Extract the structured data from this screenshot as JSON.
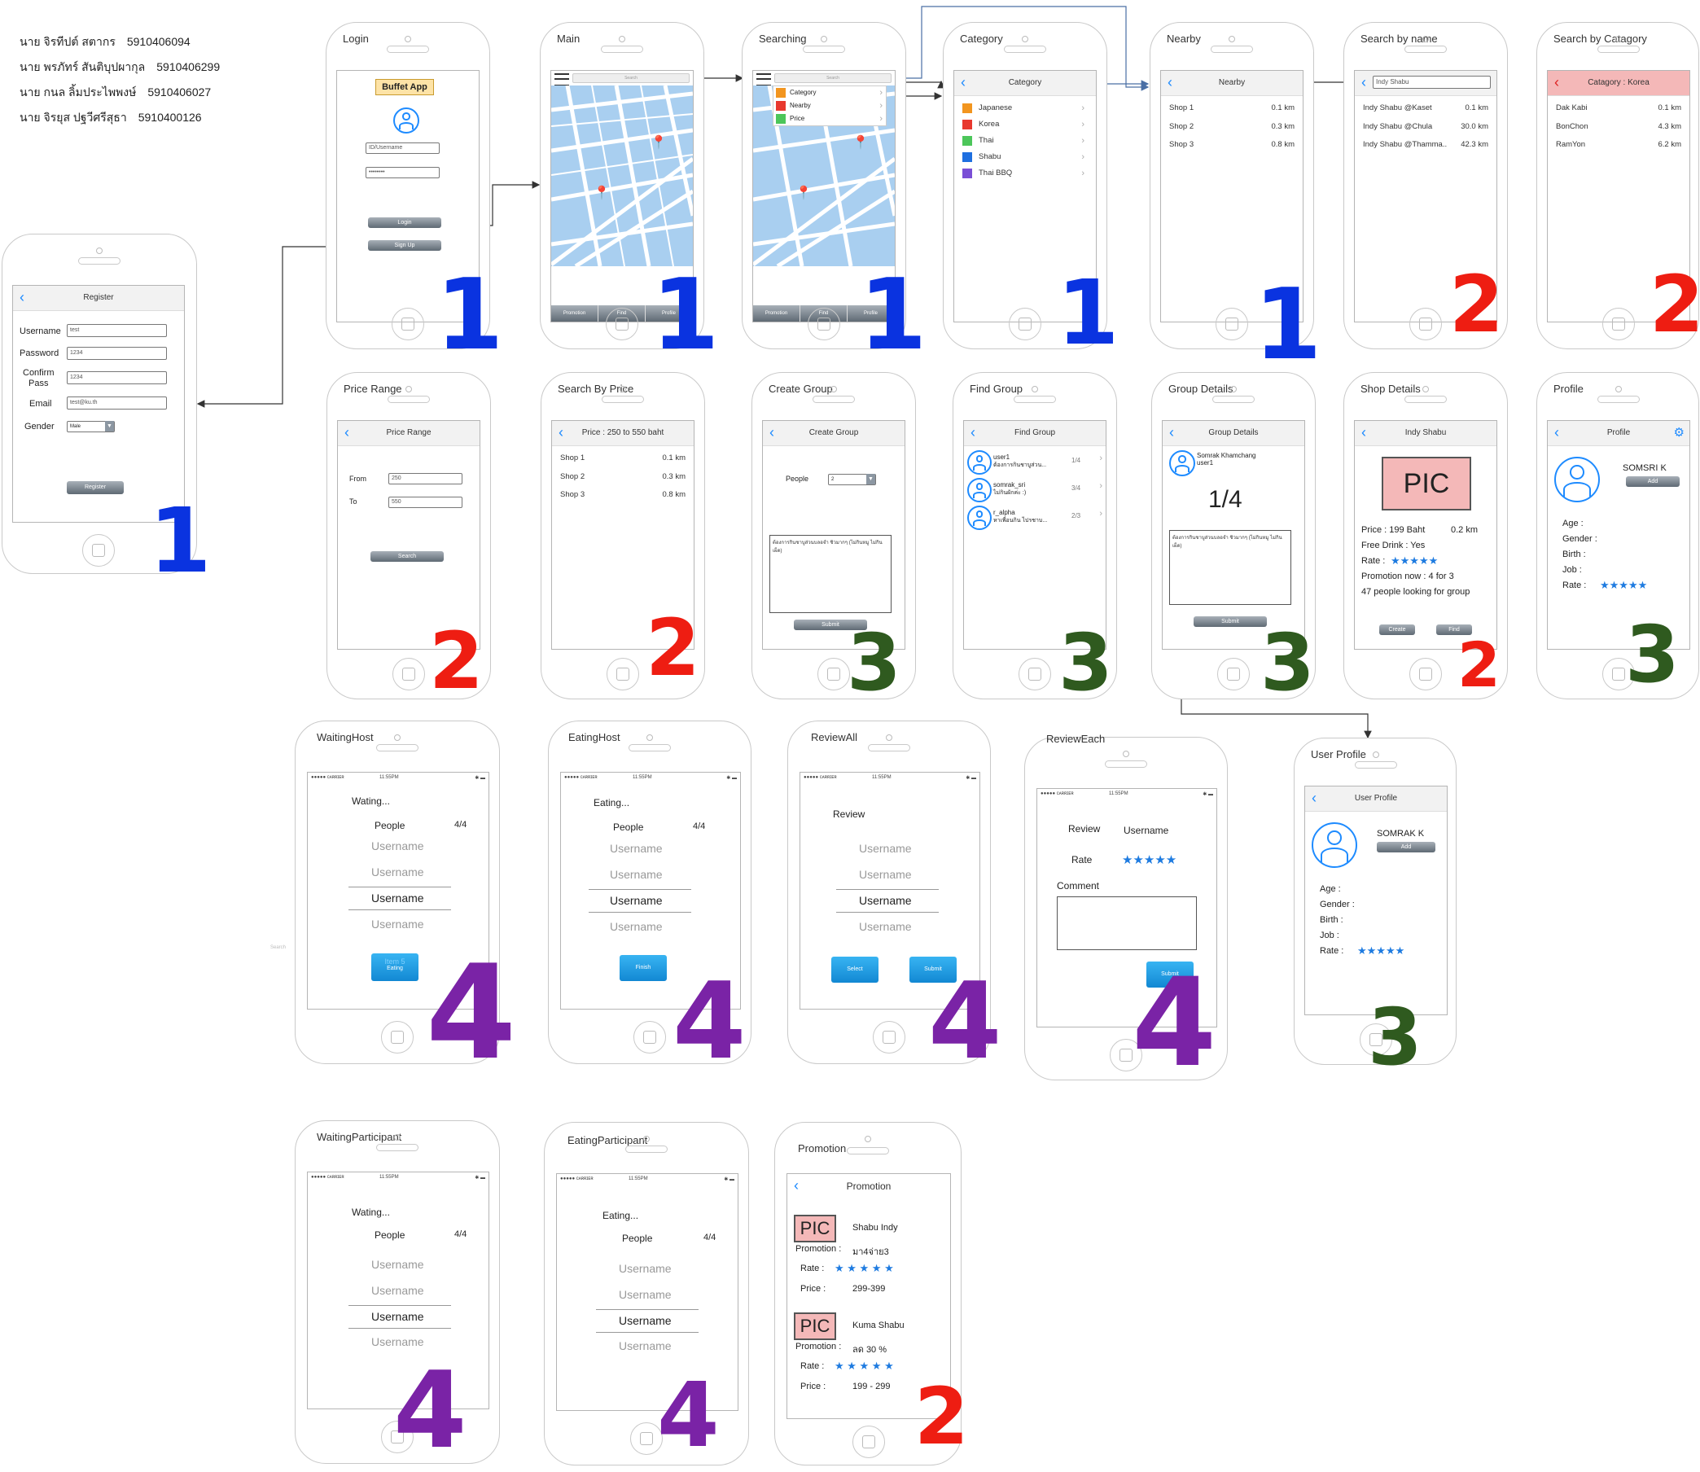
{
  "members": [
    {
      "name": "นาย จิรทีปต์ สตากร",
      "id": "5910406094"
    },
    {
      "name": "นาย พรภัทร์ สันติบุปผากุล",
      "id": "5910406299"
    },
    {
      "name": "นาย กนล ลิ้มประไพพงษ์",
      "id": "5910406027"
    },
    {
      "name": "นาย จิรยุส ปฐวีศรีสุธา",
      "id": "5910400126"
    }
  ],
  "screens": {
    "login": {
      "title": "Login",
      "app_name": "Buffet App",
      "username": "ID/Username",
      "password": "••••••••",
      "login_btn": "Login",
      "signup_btn": "Sign Up",
      "mark": "1"
    },
    "register": {
      "title": "Register",
      "nav": "Register",
      "username_lbl": "Username",
      "username_val": "test",
      "password_lbl": "Password",
      "password_val": "1234",
      "confirm_lbl": "Confirm",
      "confirm_lbl2": "Pass",
      "confirm_val": "1234",
      "email_lbl": "Email",
      "email_val": "test@ku.th",
      "gender_lbl": "Gender",
      "gender_val": "Male",
      "register_btn": "Register",
      "mark": "1"
    },
    "main": {
      "title": "Main",
      "search": "Search",
      "tabs": [
        "Promotion",
        "Find",
        "Profile"
      ],
      "mark": "1"
    },
    "searching": {
      "title": "Searching",
      "search": "Search",
      "menu": [
        "Category",
        "Nearby",
        "Price"
      ],
      "menu_colors": [
        "#f2951f",
        "#e8382e",
        "#4cc65a"
      ],
      "tabs": [
        "Promotion",
        "Find",
        "Profile"
      ],
      "mark": "1"
    },
    "category": {
      "title": "Category",
      "nav": "Category",
      "items": [
        "Japanese",
        "Korea",
        "Thai",
        "Shabu",
        "Thai BBQ"
      ],
      "colors": [
        "#f2951f",
        "#e8382e",
        "#4cc65a",
        "#1e6fe0",
        "#7a4fd6"
      ],
      "mark": "1"
    },
    "nearby": {
      "title": "Nearby",
      "nav": "Nearby",
      "rows": [
        [
          "Shop 1",
          "0.1 km"
        ],
        [
          "Shop 2",
          "0.3 km"
        ],
        [
          "Shop 3",
          "0.8 km"
        ]
      ],
      "mark": "1"
    },
    "search_by_name": {
      "title": "Search by name",
      "query": "Indy Shabu",
      "rows": [
        [
          "Indy Shabu @Kaset",
          "0.1 km"
        ],
        [
          "Indy Shabu @Chula",
          "30.0 km"
        ],
        [
          "Indy Shabu @Thamma..",
          "42.3 km"
        ]
      ],
      "mark": "2"
    },
    "search_by_category": {
      "title": "Search by Catagory",
      "nav": "Catagory : Korea",
      "rows": [
        [
          "Dak Kabi",
          "0.1 km"
        ],
        [
          "BonChon",
          "4.3 km"
        ],
        [
          "RamYon",
          "6.2 km"
        ]
      ],
      "mark": "2"
    },
    "price_range": {
      "title": "Price Range",
      "nav": "Price Range",
      "from_lbl": "From",
      "from_val": "250",
      "to_lbl": "To",
      "to_val": "550",
      "search_btn": "Search",
      "mark": "2"
    },
    "search_by_price": {
      "title": "Search By Price",
      "nav": "Price : 250 to 550 baht",
      "rows": [
        [
          "Shop 1",
          "0.1 km"
        ],
        [
          "Shop 2",
          "0.3 km"
        ],
        [
          "Shop 3",
          "0.8 km"
        ]
      ],
      "mark": "2"
    },
    "create_group": {
      "title": "Create Group",
      "nav": "Create Group",
      "people_lbl": "People",
      "people_val": "2",
      "note": "ต้องการกินชาบูส่วนบลอจำ ชิวมากๆ (ไม่กินหมู ไม่กินเผ็ด)",
      "submit_btn": "Submit",
      "mark": "3"
    },
    "find_group": {
      "title": "Find Group",
      "nav": "Find Group",
      "groups": [
        {
          "user": "user1",
          "msg": "ต้องการกินชาบูส่วน...",
          "count": "1/4"
        },
        {
          "user": "somrak_sri",
          "msg": "ไม่กินผักค่ะ :)",
          "count": "3/4"
        },
        {
          "user": "r_alpha",
          "msg": "หาเพื่อนกิน ไปรชาบ...",
          "count": "2/3"
        }
      ],
      "mark": "3"
    },
    "group_details": {
      "title": "Group Details",
      "nav": "Group Details",
      "host_name": "Somrak Khamchang",
      "host_user": "user1",
      "count": "1/4",
      "note": "ต้องการกินชาบูส่วนบลอจำ ชิวมากๆ (ไม่กินหมู ไม่กินเผ็ด)",
      "submit_btn": "Submit",
      "mark": "3"
    },
    "shop_details": {
      "title": "Shop Details",
      "nav": "Indy Shabu",
      "pic": "PIC",
      "price": "Price : 199 Baht",
      "distance": "0.2 km",
      "drink": "Free Drink : Yes",
      "rate_lbl": "Rate :",
      "stars": "★★★★★",
      "promo": "Promotion now : 4 for 3",
      "looking": "47 people looking for group",
      "create_btn": "Create",
      "find_btn": "Find",
      "mark": "2"
    },
    "profile": {
      "title": "Profile",
      "nav": "Profile",
      "name": "SOMSRI K",
      "add_btn": "Add",
      "fields": [
        "Age :",
        "Gender :",
        "Birth :",
        "Job :"
      ],
      "rate_lbl": "Rate :",
      "stars": "★★★★★",
      "mark": "3"
    },
    "waiting_host": {
      "title": "WaitingHost",
      "status": "Wating...",
      "people_lbl": "People",
      "people_val": "4/4",
      "users": [
        "Username",
        "Username",
        "Username",
        "Username"
      ],
      "btn": "Eating",
      "btn_ghost": "Item 5",
      "mark": "4"
    },
    "eating_host": {
      "title": "EatingHost",
      "status": "Eating...",
      "people_lbl": "People",
      "people_val": "4/4",
      "users": [
        "Username",
        "Username",
        "Username",
        "Username"
      ],
      "btn": "Finish",
      "mark": "4"
    },
    "review_all": {
      "title": "ReviewAll",
      "heading": "Review",
      "users": [
        "Username",
        "Username",
        "Username",
        "Username"
      ],
      "select_btn": "Select",
      "submit_btn": "Submit",
      "mark": "4"
    },
    "review_each": {
      "title": "ReviewEach",
      "heading": "Review",
      "user": "Username",
      "rate_lbl": "Rate",
      "stars": "★★★★★",
      "comment_lbl": "Comment",
      "submit_btn": "Submit",
      "mark": "4"
    },
    "user_profile": {
      "title": "User Profile",
      "nav": "User Profile",
      "name": "SOMRAK K",
      "add_btn": "Add",
      "fields": [
        "Age :",
        "Gender :",
        "Birth :",
        "Job :"
      ],
      "rate_lbl": "Rate :",
      "stars": "★★★★★",
      "mark": "3"
    },
    "waiting_participant": {
      "title": "WaitingParticipant",
      "status": "Wating...",
      "people_lbl": "People",
      "people_val": "4/4",
      "users": [
        "Username",
        "Username",
        "Username",
        "Username"
      ],
      "mark": "4"
    },
    "eating_participant": {
      "title": "EatingParticipant",
      "status": "Eating...",
      "people_lbl": "People",
      "people_val": "4/4",
      "users": [
        "Username",
        "Username",
        "Username",
        "Username"
      ],
      "mark": "4"
    },
    "promotion": {
      "title": "Promotion",
      "nav": "Promotion",
      "items": [
        {
          "pic": "PIC",
          "name": "Shabu Indy",
          "promo_lbl": "Promotion :",
          "promo": "มา4จ่าย3",
          "rate_lbl": "Rate :",
          "stars": "★ ★ ★ ★ ★",
          "price_lbl": "Price :",
          "price": "299-399"
        },
        {
          "pic": "PIC",
          "name": "Kuma Shabu",
          "promo_lbl": "Promotion :",
          "promo": "ลด 30 %",
          "rate_lbl": "Rate :",
          "stars": "★ ★ ★ ★ ★",
          "price_lbl": "Price :",
          "price": "199 - 299"
        }
      ],
      "mark": "2"
    }
  },
  "status_bar": {
    "carrier": "●●●●● ᴄᴀʀʀɪᴇʀ",
    "time": "11:55PM"
  },
  "stray_label": "Search",
  "colors": {
    "mark1": "#0a33e0",
    "mark2": "#ee1d12",
    "mark3": "#2f5a1f",
    "mark4": "#7a23a6",
    "link_blue": "#1e8bff"
  }
}
